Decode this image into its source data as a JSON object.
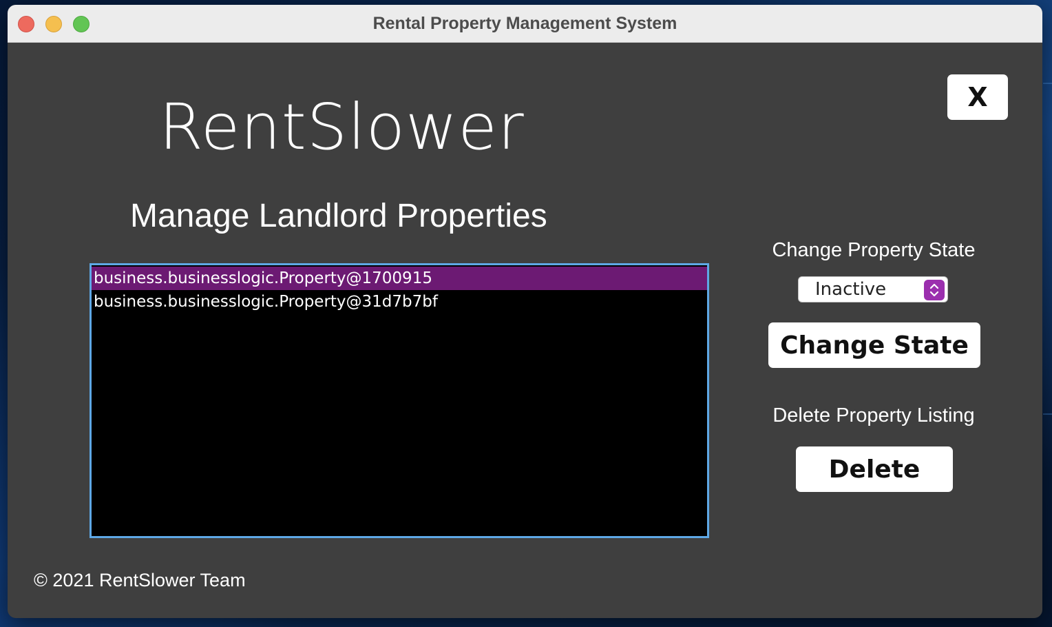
{
  "window": {
    "title": "Rental Property Management System"
  },
  "header": {
    "close_label": "X",
    "logo": "RentSlower",
    "heading": "Manage Landlord Properties"
  },
  "properties": {
    "items": [
      "business.businesslogic.Property@1700915",
      "business.businesslogic.Property@31d7b7bf"
    ],
    "selected_index": 0
  },
  "state_panel": {
    "label": "Change Property State",
    "selected_state": "Inactive",
    "button_label": "Change State"
  },
  "delete_panel": {
    "label": "Delete Property Listing",
    "button_label": "Delete"
  },
  "footer": {
    "text": "© 2021 RentSlower Team"
  },
  "colors": {
    "window_bg": "#3f3f3f",
    "list_bg": "#000000",
    "selection": "#6c1a73",
    "list_border": "#5ea8e6",
    "select_accent": "#9b2fae"
  },
  "icons": {
    "close": "close-icon",
    "select_arrows": "chevron-up-down-icon"
  }
}
